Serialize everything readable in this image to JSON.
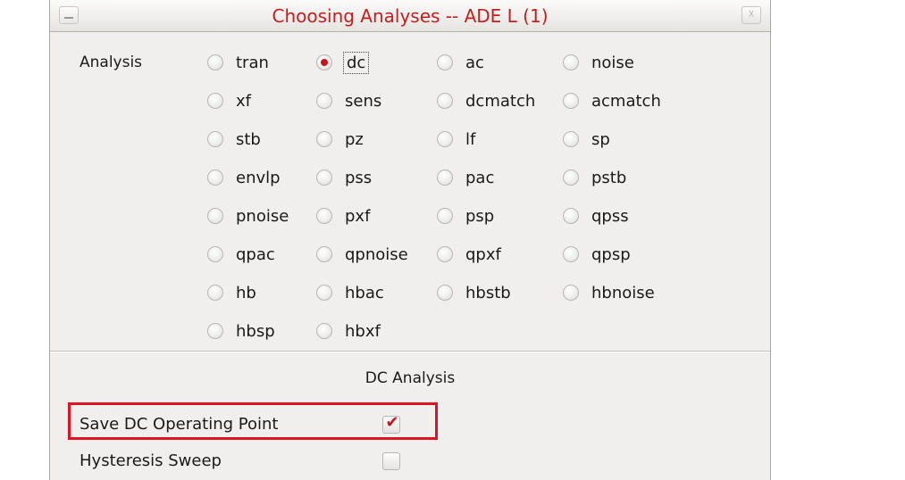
{
  "window": {
    "title": "Choosing Analyses -- ADE L (1)",
    "close_glyph": "☓"
  },
  "analysis": {
    "label": "Analysis",
    "selected": "dc",
    "options": [
      [
        "tran",
        "dc",
        "ac",
        "noise"
      ],
      [
        "xf",
        "sens",
        "dcmatch",
        "acmatch"
      ],
      [
        "stb",
        "pz",
        "lf",
        "sp"
      ],
      [
        "envlp",
        "pss",
        "pac",
        "pstb"
      ],
      [
        "pnoise",
        "pxf",
        "psp",
        "qpss"
      ],
      [
        "qpac",
        "qpnoise",
        "qpxf",
        "qpsp"
      ],
      [
        "hb",
        "hbac",
        "hbstb",
        "hbnoise"
      ],
      [
        "hbsp",
        "hbxf"
      ]
    ]
  },
  "dc_section": {
    "title": "DC Analysis",
    "options": [
      {
        "label": "Save DC Operating Point",
        "checked": true
      },
      {
        "label": "Hysteresis Sweep",
        "checked": false
      }
    ],
    "check_glyph": "✔"
  },
  "colors": {
    "accent": "#c8141e",
    "title": "#c41e1e",
    "highlight": "#e0141e"
  }
}
